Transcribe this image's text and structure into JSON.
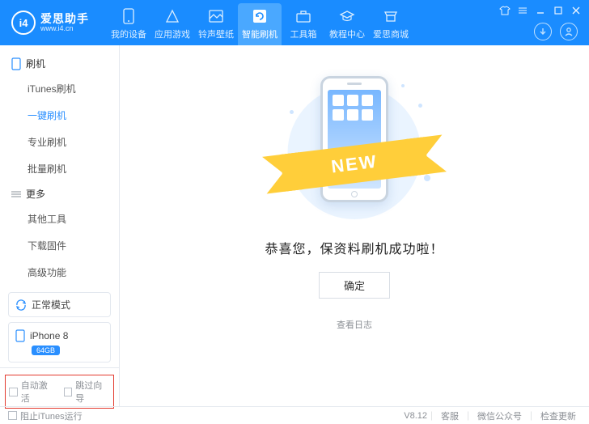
{
  "logo": {
    "glyph": "i4",
    "name": "爱思助手",
    "domain": "www.i4.cn"
  },
  "nav": {
    "items": [
      {
        "label": "我的设备"
      },
      {
        "label": "应用游戏"
      },
      {
        "label": "铃声壁纸"
      },
      {
        "label": "智能刷机"
      },
      {
        "label": "工具箱"
      },
      {
        "label": "教程中心"
      },
      {
        "label": "爱思商城"
      }
    ],
    "active_index": 3
  },
  "sidebar": {
    "section_flash": {
      "title": "刷机",
      "items": [
        "iTunes刷机",
        "一键刷机",
        "专业刷机",
        "批量刷机"
      ],
      "active_index": 1
    },
    "section_more": {
      "title": "更多",
      "items": [
        "其他工具",
        "下载固件",
        "高级功能"
      ]
    },
    "mode_label": "正常模式",
    "device": {
      "name": "iPhone 8",
      "capacity": "64GB"
    },
    "opts": {
      "auto_activate": "自动激活",
      "skip_guide": "跳过向导"
    }
  },
  "content": {
    "ribbon": "NEW",
    "success": "恭喜您，保资料刷机成功啦！",
    "ok": "确定",
    "view_log": "查看日志"
  },
  "footer": {
    "block_itunes": "阻止iTunes运行",
    "version": "V8.12",
    "links": [
      "客服",
      "微信公众号",
      "检查更新"
    ]
  }
}
